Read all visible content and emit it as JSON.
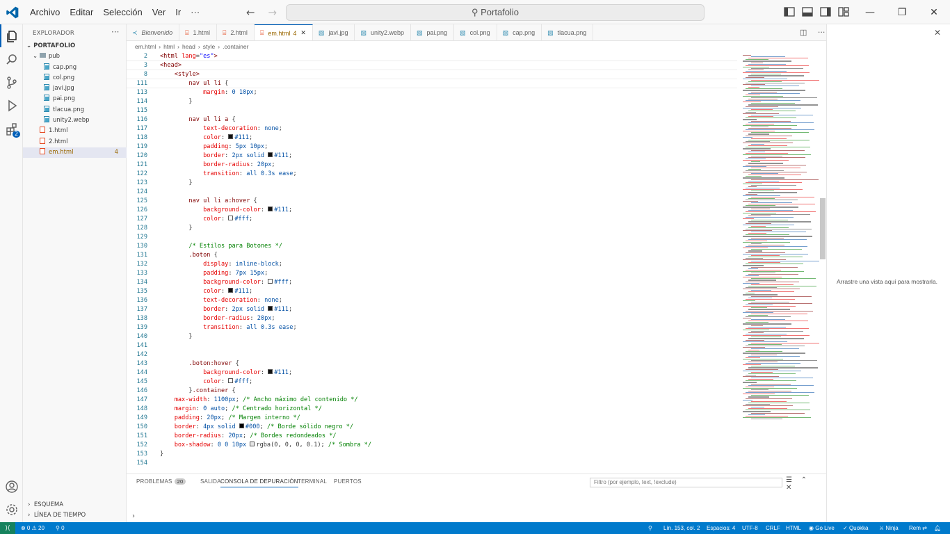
{
  "titlebar": {
    "menu": [
      "Archivo",
      "Editar",
      "Selección",
      "Ver",
      "Ir",
      "···"
    ],
    "search": "Portafolio"
  },
  "sidebar": {
    "title": "EXPLORADOR",
    "root": "PORTAFOLIO",
    "folder": "pub",
    "files": [
      {
        "name": "cap.png",
        "type": "png",
        "indent": 2
      },
      {
        "name": "col.png",
        "type": "png",
        "indent": 2
      },
      {
        "name": "javi.jpg",
        "type": "png",
        "indent": 2
      },
      {
        "name": "pai.png",
        "type": "png",
        "indent": 2
      },
      {
        "name": "tlacua.png",
        "type": "png",
        "indent": 2
      },
      {
        "name": "unity2.webp",
        "type": "png",
        "indent": 2
      },
      {
        "name": "1.html",
        "type": "html",
        "indent": 1
      },
      {
        "name": "2.html",
        "type": "html",
        "indent": 1
      },
      {
        "name": "em.html",
        "type": "html",
        "indent": 1,
        "selected": true,
        "count": "4"
      }
    ],
    "outline": "ESQUEMA",
    "timeline": "LÍNEA DE TIEMPO"
  },
  "tabs": [
    {
      "label": "Bienvenido",
      "icon": "vscode"
    },
    {
      "label": "1.html",
      "icon": "html"
    },
    {
      "label": "2.html",
      "icon": "html"
    },
    {
      "label": "em.html",
      "icon": "html",
      "active": true,
      "num": "4"
    },
    {
      "label": "javi.jpg",
      "icon": "img"
    },
    {
      "label": "unity2.webp",
      "icon": "img"
    },
    {
      "label": "pai.png",
      "icon": "img"
    },
    {
      "label": "col.png",
      "icon": "img"
    },
    {
      "label": "cap.png",
      "icon": "img"
    },
    {
      "label": "tlacua.png",
      "icon": "img"
    }
  ],
  "breadcrumb": [
    "em.html",
    "html",
    "head",
    "style",
    ".container"
  ],
  "sticky": [
    {
      "n": "2",
      "html": "<span class='k'>&lt;html</span> <span class='a'>lang</span>=<span class='q'>\"es\"</span><span class='k'>&gt;</span>"
    },
    {
      "n": "3",
      "html": "<span class='k'>&lt;head&gt;</span>"
    },
    {
      "n": "8",
      "html": "    <span class='k'>&lt;style&gt;</span>"
    },
    {
      "n": "111",
      "html": "        <span class='t'>nav ul li</span> {"
    }
  ],
  "code": [
    {
      "n": "113",
      "html": "            <span class='p'>margin</span>: <span class='v'>0 10px</span>;"
    },
    {
      "n": "114",
      "html": "        }"
    },
    {
      "n": "115",
      "html": ""
    },
    {
      "n": "116",
      "html": "        <span class='t'>nav ul li a</span> {"
    },
    {
      "n": "117",
      "html": "            <span class='p'>text-decoration</span>: <span class='v'>none</span>;"
    },
    {
      "n": "118",
      "html": "            <span class='p'>color</span>: <span class='sw' style='background:#111'></span><span class='v'>#111</span>;"
    },
    {
      "n": "119",
      "html": "            <span class='p'>padding</span>: <span class='v'>5px 10px</span>;"
    },
    {
      "n": "120",
      "html": "            <span class='p'>border</span>: <span class='v'>2px solid</span> <span class='sw' style='background:#111'></span><span class='v'>#111</span>;"
    },
    {
      "n": "121",
      "html": "            <span class='p'>border-radius</span>: <span class='v'>20px</span>;"
    },
    {
      "n": "122",
      "html": "            <span class='p'>transition</span>: <span class='v'>all 0.3s ease</span>;"
    },
    {
      "n": "123",
      "html": "        }"
    },
    {
      "n": "124",
      "html": ""
    },
    {
      "n": "125",
      "html": "        <span class='t'>nav ul li a:hover</span> {"
    },
    {
      "n": "126",
      "html": "            <span class='p'>background-color</span>: <span class='sw' style='background:#111'></span><span class='v'>#111</span>;"
    },
    {
      "n": "127",
      "html": "            <span class='p'>color</span>: <span class='sw' style='background:#fff'></span><span class='v'>#fff</span>;"
    },
    {
      "n": "128",
      "html": "        }"
    },
    {
      "n": "129",
      "html": ""
    },
    {
      "n": "130",
      "html": "        <span class='c'>/* Estilos para Botones */</span>"
    },
    {
      "n": "131",
      "html": "        <span class='t'>.boton</span> {"
    },
    {
      "n": "132",
      "html": "            <span class='p'>display</span>: <span class='v'>inline-block</span>;"
    },
    {
      "n": "133",
      "html": "            <span class='p'>padding</span>: <span class='v'>7px 15px</span>;"
    },
    {
      "n": "134",
      "html": "            <span class='p'>background-color</span>: <span class='sw' style='background:#fff'></span><span class='v'>#fff</span>;"
    },
    {
      "n": "135",
      "html": "            <span class='p'>color</span>: <span class='sw' style='background:#111'></span><span class='v'>#111</span>;"
    },
    {
      "n": "136",
      "html": "            <span class='p'>text-decoration</span>: <span class='v'>none</span>;"
    },
    {
      "n": "137",
      "html": "            <span class='p'>border</span>: <span class='v'>2px solid</span> <span class='sw' style='background:#111'></span><span class='v'>#111</span>;"
    },
    {
      "n": "138",
      "html": "            <span class='p'>border-radius</span>: <span class='v'>20px</span>;"
    },
    {
      "n": "139",
      "html": "            <span class='p'>transition</span>: <span class='v'>all 0.3s ease</span>;"
    },
    {
      "n": "140",
      "html": "        }"
    },
    {
      "n": "141",
      "html": ""
    },
    {
      "n": "142",
      "html": ""
    },
    {
      "n": "143",
      "html": "        <span class='t'>.boton:hover</span> {"
    },
    {
      "n": "144",
      "html": "            <span class='p'>background-color</span>: <span class='sw' style='background:#111'></span><span class='v'>#111</span>;"
    },
    {
      "n": "145",
      "html": "            <span class='p'>color</span>: <span class='sw' style='background:#fff'></span><span class='v'>#fff</span>;"
    },
    {
      "n": "146",
      "html": "        }<span class='t'>.container</span> {"
    },
    {
      "n": "147",
      "html": "    <span class='p'>max-width</span>: <span class='v'>1100px</span>; <span class='c'>/* Ancho máximo del contenido */</span>"
    },
    {
      "n": "148",
      "html": "    <span class='p'>margin</span>: <span class='v'>0 auto</span>; <span class='c'>/* Centrado horizontal */</span>"
    },
    {
      "n": "149",
      "html": "    <span class='p'>padding</span>: <span class='v'>20px</span>; <span class='c'>/* Margen interno */</span>"
    },
    {
      "n": "150",
      "html": "    <span class='p'>border</span>: <span class='v'>4px solid</span> <span class='sw' style='background:#000'></span><span class='v'>#000</span>; <span class='c'>/* Borde sólido negro */</span>"
    },
    {
      "n": "151",
      "html": "    <span class='p'>border-radius</span>: <span class='v'>20px</span>; <span class='c'>/* Bordes redondeados */</span>"
    },
    {
      "n": "152",
      "html": "    <span class='p'>box-shadow</span>: <span class='v'>0 0 10px</span> <span class='sw' style='background:rgba(0,0,0,0.1)'></span><span class='g'>rgba(0, 0, 0, 0.1)</span>; <span class='c'>/* Sombra */</span>"
    },
    {
      "n": "153",
      "html": "<span class='g'>}</span>"
    },
    {
      "n": "154",
      "html": ""
    }
  ],
  "right_pane": {
    "text": "Arrastre una vista aquí para mostrarla."
  },
  "panel": {
    "tabs": [
      {
        "label": "PROBLEMAS",
        "badge": "20"
      },
      {
        "label": "SALIDA"
      },
      {
        "label": "CONSOLA DE DEPURACIÓN",
        "active": true
      },
      {
        "label": "TERMINAL"
      },
      {
        "label": "PUERTOS"
      }
    ],
    "filter_placeholder": "Filtro (por ejemplo, text, !exclude)"
  },
  "statusbar": {
    "errors": "⊗ 0 ⚠ 20",
    "ports": "⚲ 0",
    "position": "Lín. 153, col. 2",
    "spaces": "Espacios: 4",
    "encoding": "UTF-8",
    "eol": "CRLF",
    "language": "HTML",
    "golive": "Go Live",
    "quokka": "Quokka",
    "ninja": "Ninja",
    "rem": "Rem"
  },
  "colors": {
    "accent": "#005fb8",
    "statusbar": "#007acc",
    "remote": "#16825d"
  }
}
